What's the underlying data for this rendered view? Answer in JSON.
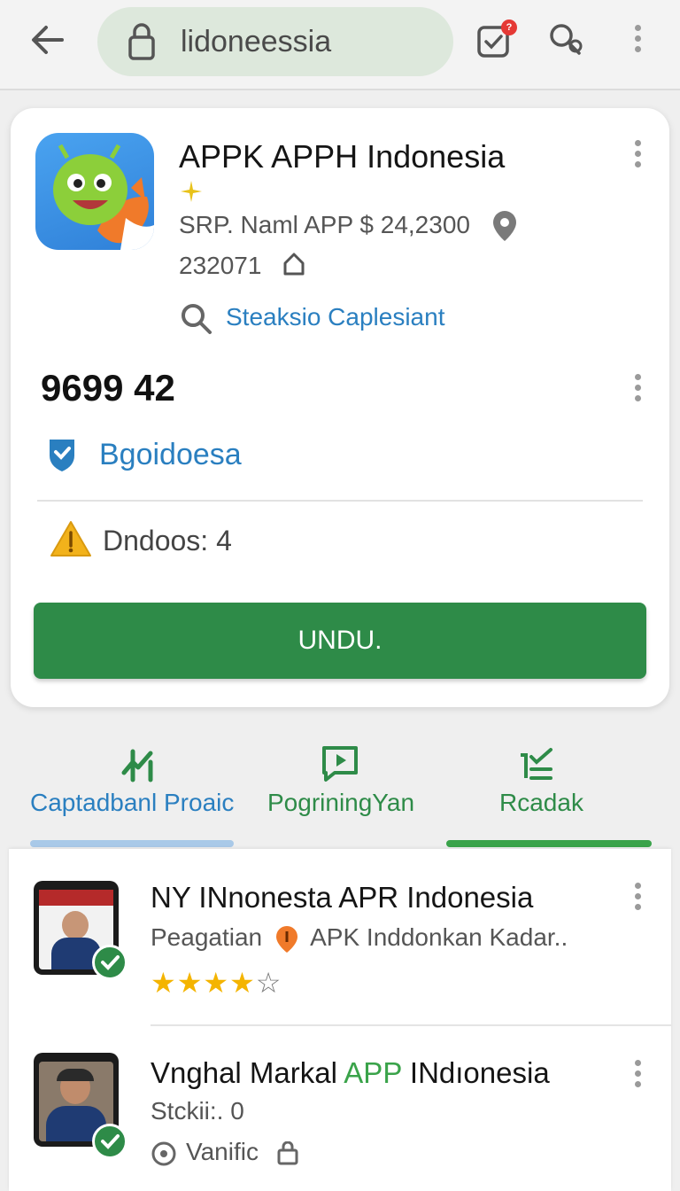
{
  "browser": {
    "url": "lidoneessia",
    "notification_count": "?"
  },
  "app": {
    "title": "APPK APPH Indonesia",
    "price_line": "SRP. Naml APP $ 24,2300",
    "code": "232071",
    "search_link": "Steaksio Caplesiant",
    "big_number": "9699 42",
    "shield_label": "Bgoidoesa",
    "warning_label": "Dndoos: 4",
    "download_button": "UNDU."
  },
  "tabs": [
    {
      "label": "Captadbanl Proaic",
      "icon": "trend-icon",
      "color": "#2a7fc0"
    },
    {
      "label": "PogriningYan",
      "icon": "play-message-icon",
      "color": "#2e8b48"
    },
    {
      "label": "Rcadak",
      "icon": "checklist-icon",
      "color": "#2e8b48"
    }
  ],
  "list": [
    {
      "title": "NY INnonesta APR Indonesia",
      "subtitle_left": "Peagatian",
      "subtitle_right": "APK Inddonkan Kadar..",
      "rating": 4,
      "rating_max": 5
    },
    {
      "title_part1": "Vnghal Markal ",
      "title_accent": "APP",
      "title_part2": " INdıonesia",
      "subtitle": "Stckii:. 0",
      "meta_label": "Vanific"
    }
  ],
  "colors": {
    "primary_green": "#2e8b48",
    "link_blue": "#2a7fc0",
    "star": "#f4b400"
  }
}
